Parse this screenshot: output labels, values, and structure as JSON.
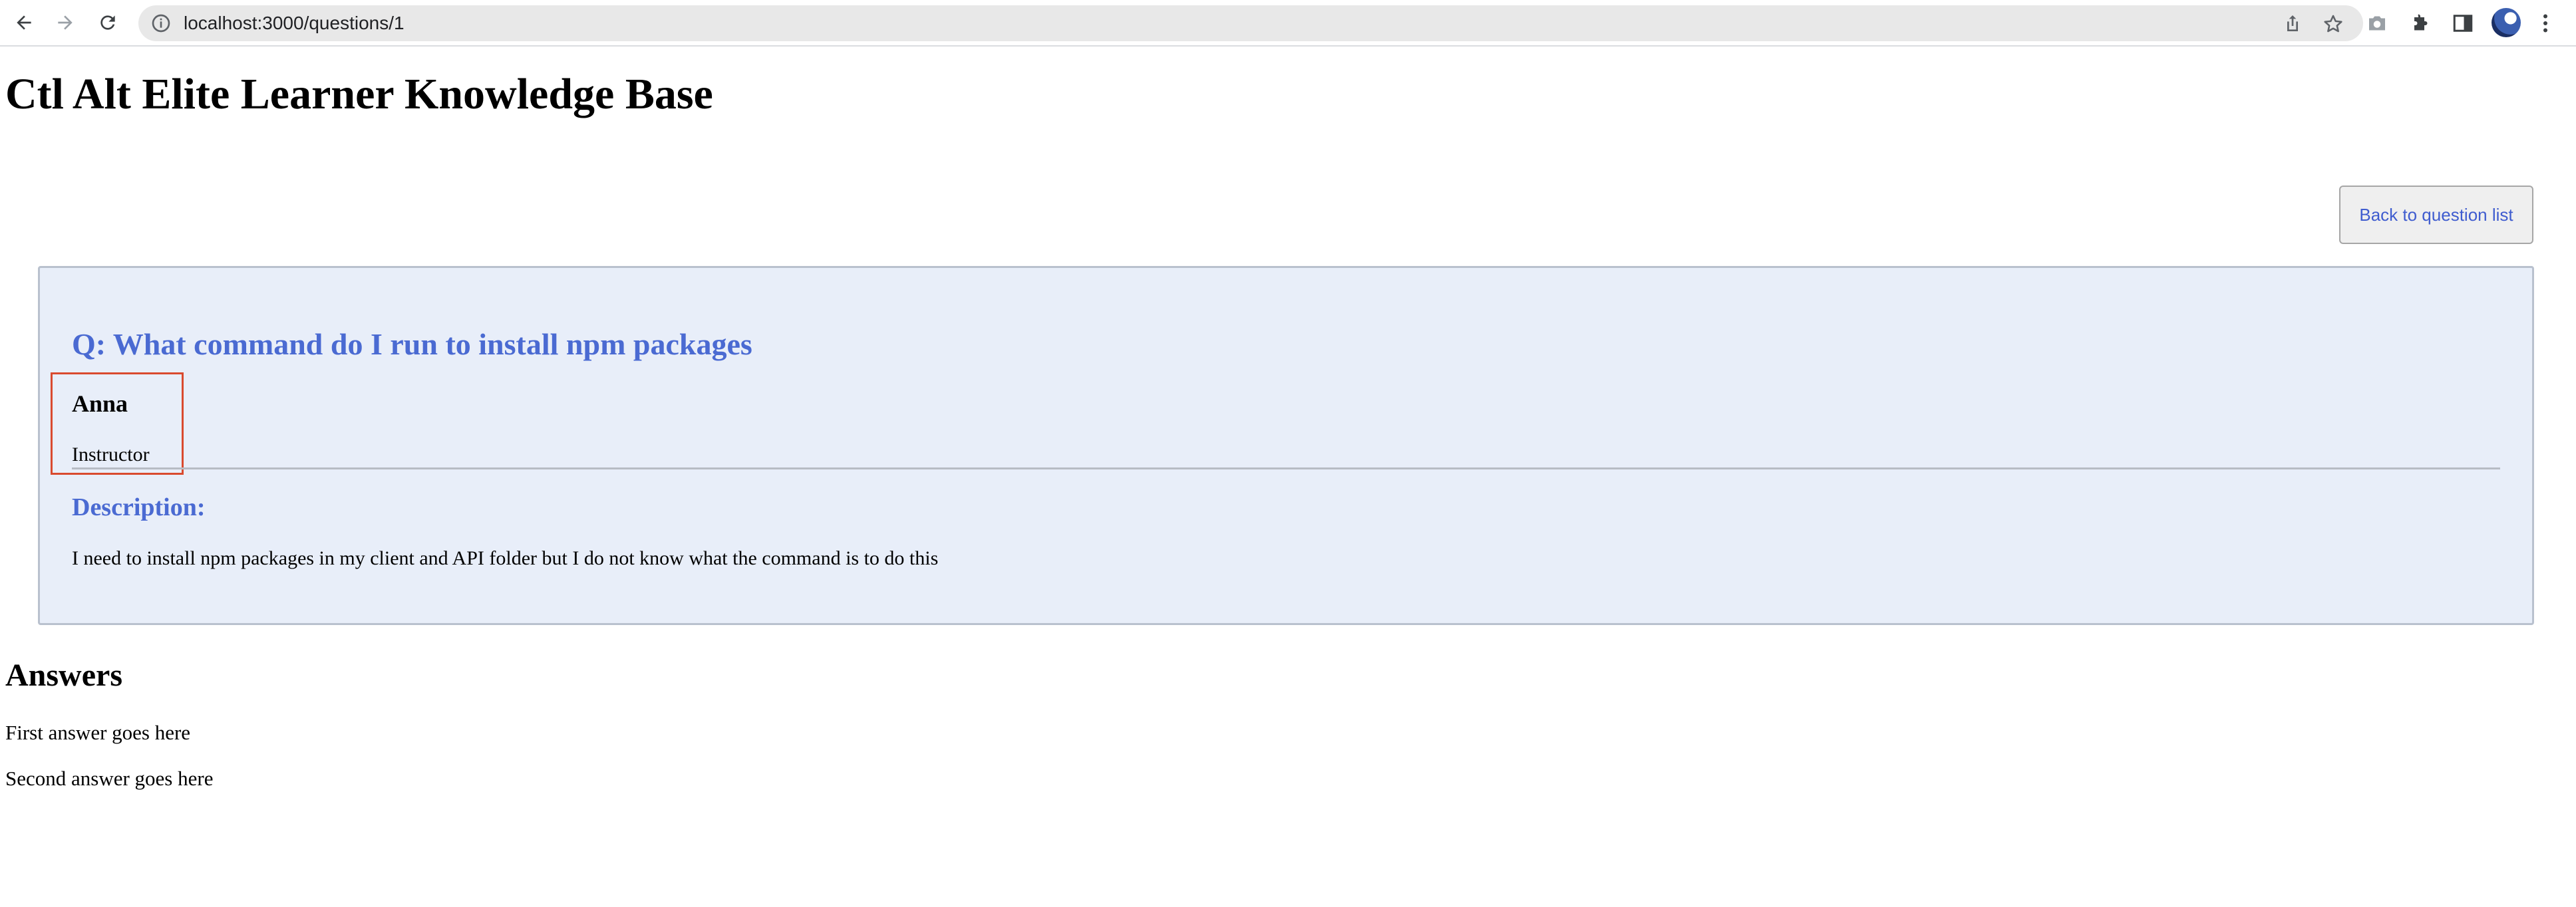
{
  "browser": {
    "url": "localhost:3000/questions/1",
    "icons": [
      "back-arrow-icon",
      "forward-arrow-icon",
      "reload-icon",
      "site-info-icon",
      "share-icon",
      "bookmark-star-icon",
      "camera-icon",
      "extensions-icon",
      "side-panel-icon",
      "profile-avatar",
      "more-menu-icon"
    ]
  },
  "page": {
    "title": "Ctl Alt Elite Learner Knowledge Base",
    "back_button_label": "Back to question list"
  },
  "question": {
    "title": "Q: What command do I run to install npm packages",
    "author_name": "Anna",
    "author_role": "Instructor",
    "description_heading": "Description:",
    "description": "I need to install npm packages in my client and API folder but I do not know what the command is to do this"
  },
  "answers": {
    "heading": "Answers",
    "items": [
      "First answer goes here",
      "Second answer goes here"
    ]
  },
  "colors": {
    "accent_blue": "#4a6ad2",
    "card_background": "#e8eef9",
    "highlight_red": "#d94a2f"
  }
}
